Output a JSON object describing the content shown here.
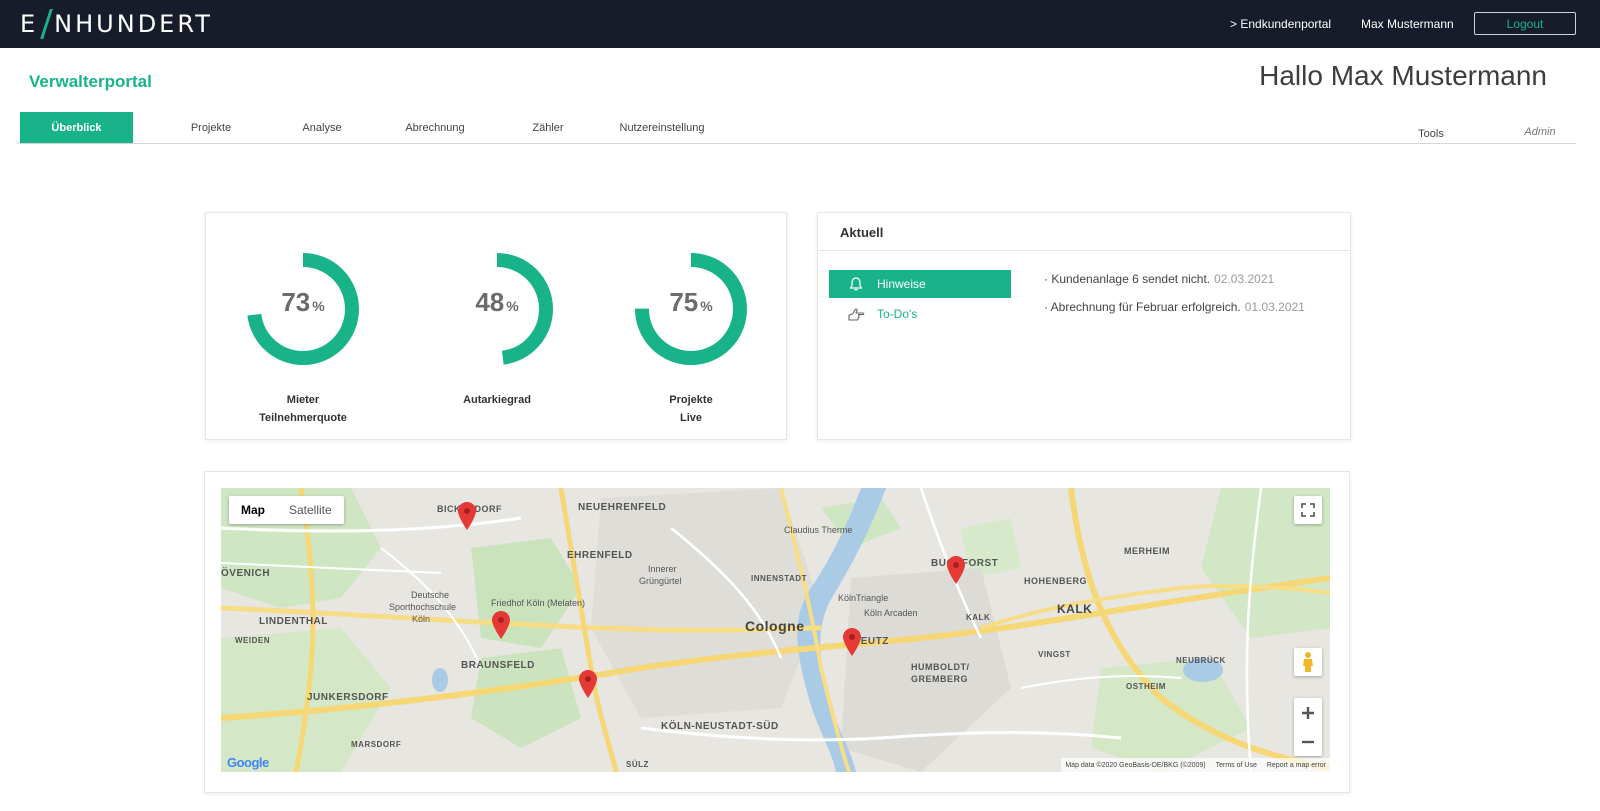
{
  "topbar": {
    "logo_left": "E",
    "logo_right": "NHUNDERT",
    "endkunden_link": "> Endkundenportal",
    "user_name": "Max Mustermann",
    "logout_label": "Logout"
  },
  "header": {
    "portal_title": "Verwalterportal",
    "greeting": "Hallo Max Mustermann"
  },
  "tabs": [
    {
      "label": "Überblick",
      "active": true
    },
    {
      "label": "Projekte"
    },
    {
      "label": "Analyse"
    },
    {
      "label": "Abrechnung"
    },
    {
      "label": "Zähler"
    },
    {
      "label": "Nutzereinstellung"
    },
    {
      "label": "Tools"
    },
    {
      "label": "Admin"
    }
  ],
  "kpis": [
    {
      "value": 73,
      "unit": "%",
      "label_line1": "Mieter",
      "label_line2": "Teilnehmerquote"
    },
    {
      "value": 48,
      "unit": "%",
      "label_line1": "Autarkiegrad",
      "label_line2": ""
    },
    {
      "value": 75,
      "unit": "%",
      "label_line1": "Projekte",
      "label_line2": "Live"
    }
  ],
  "aktuell": {
    "title": "Aktuell",
    "hinweise_label": "Hinweise",
    "todos_label": "To-Do's",
    "items": [
      {
        "text": "· Kundenanlage 6 sendet nicht.",
        "date": "02.03.2021"
      },
      {
        "text": "· Abrechnung für Februar erfolgreich.",
        "date": "01.03.2021"
      }
    ]
  },
  "map": {
    "type_map": "Map",
    "type_satellite": "Satellite",
    "google": "Google",
    "footer_data": "Map data ©2020 GeoBasis-DE/BKG (©2009)",
    "footer_terms": "Terms of Use",
    "footer_report": "Report a map error",
    "labels": {
      "neuehrenfeld": "NEUEHRENFELD",
      "bickendorf": "BICKENDORF",
      "ehrenfeld": "EHRENFELD",
      "innerer": "Innerer",
      "gruenguertel": "Grüngürtel",
      "lovenich": "ÖVENICH",
      "lindenthal": "LINDENTHAL",
      "weiden": "WEIDEN",
      "deutsche": "Deutsche",
      "sporthochschule": "Sporthochschule",
      "koeln": "Köln",
      "melaten": "Friedhof Köln (Melaten)",
      "braunsfeld": "BRAUNSFELD",
      "junkersdorf": "JUNKERSDORF",
      "marsdorf": "MARSDORF",
      "cologne": "Cologne",
      "innenstadt": "INNENSTADT",
      "neustadt": "KÖLN-NEUSTADT-SÜD",
      "claudius": "Claudius Therme",
      "koelntriangle": "KölnTriangle",
      "koelnarcaden": "Köln Arcaden",
      "deutz": "DEUTZ",
      "buchforst": "BUCHFORST",
      "kalk_caps": "KALK",
      "kalk": "KALK",
      "humboldt": "HUMBOLDT/",
      "gremberg": "GREMBERG",
      "hohenberg": "HOHENBERG",
      "merheim": "MERHEIM",
      "vingst": "VINGST",
      "neubrueck": "NEUBRÜCK",
      "ostheim": "OSTHEIM",
      "sulz": "SÜLZ"
    }
  },
  "colors": {
    "accent": "#19b38a",
    "topbar": "#161c2a",
    "pin": "#e53935"
  }
}
